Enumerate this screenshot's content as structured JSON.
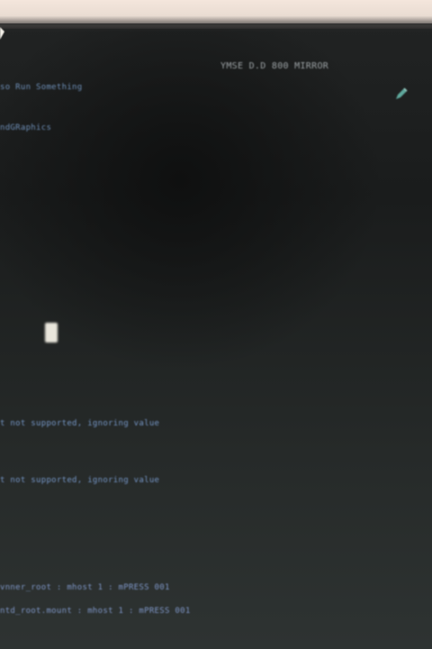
{
  "terminal": {
    "header": "YMSE D.D 800 MIRROR",
    "lines": [
      "so Run Something",
      "ndGRaphics",
      "t not supported, ignoring value",
      "t not supported, ignoring value",
      "vnner_root : mhost 1 : mPRESS 001",
      "ntd_root.mount : mhost 1 : mPRESS 001"
    ]
  },
  "icons": [
    "cursor-arrow-icon",
    "pencil-icon"
  ],
  "colors": {
    "background": "#1a1c1c",
    "text_blue": "#7596c6",
    "text_gray": "#9da3a6",
    "bezel": "#f4e6dc"
  }
}
